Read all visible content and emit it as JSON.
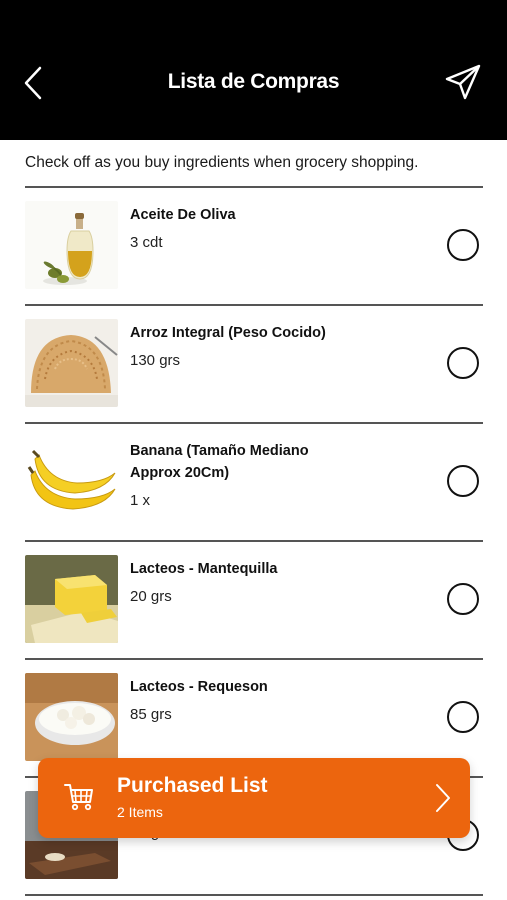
{
  "header": {
    "title": "Lista de Compras"
  },
  "subtitle": "Check off as you buy ingredients when grocery shopping.",
  "items": [
    {
      "name": "Aceite De Oliva",
      "qty": "3 cdt",
      "image": "olive-oil-bottle"
    },
    {
      "name": "Arroz Integral (Peso Cocido)",
      "qty": "130 grs",
      "image": "cooked-rice-mound"
    },
    {
      "name": "Banana (Tamaño Mediano Approx 20Cm)",
      "qty": "1 x",
      "image": "bananas"
    },
    {
      "name": "Lacteos - Mantequilla",
      "qty": "20 grs",
      "image": "butter-block"
    },
    {
      "name": "Lacteos - Requeson",
      "qty": "85 grs",
      "image": "cottage-cheese-bowl"
    },
    {
      "name": "",
      "qty": "50 grs",
      "image": "food-on-board"
    }
  ],
  "purchased": {
    "label": "Purchased List",
    "count": "2 Items"
  },
  "colors": {
    "accent": "#ec650e",
    "header": "#000000"
  }
}
